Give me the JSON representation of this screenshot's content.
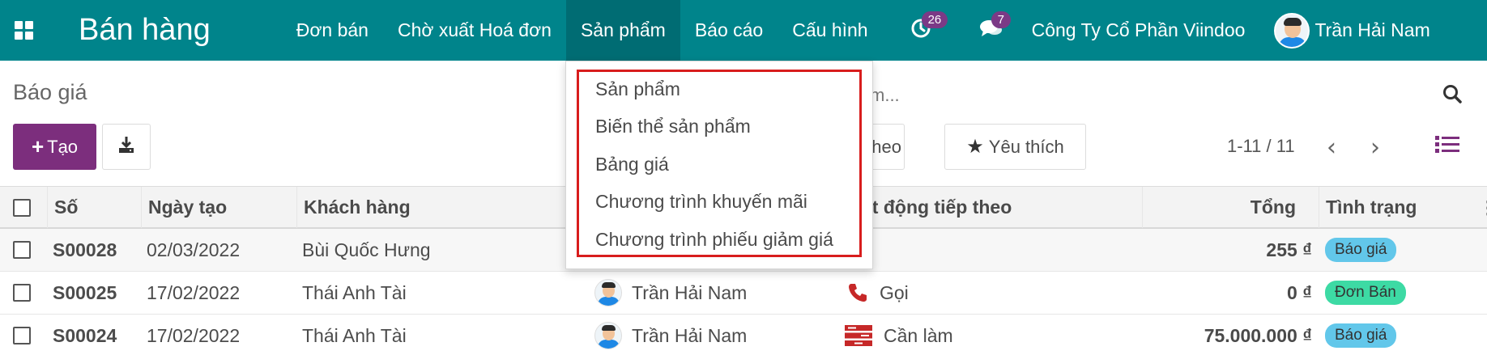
{
  "navbar": {
    "brand": "Bán hàng",
    "menu": [
      {
        "label": "Đơn bán",
        "active": false
      },
      {
        "label": "Chờ xuất Hoá đơn",
        "active": false
      },
      {
        "label": "Sản phẩm",
        "active": true
      },
      {
        "label": "Báo cáo",
        "active": false
      },
      {
        "label": "Cấu hình",
        "active": false
      }
    ],
    "activity_count": "26",
    "message_count": "7",
    "company": "Công Ty Cổ Phần Viindoo",
    "user_name": "Trần Hải Nam",
    "icons": {
      "apps": "apps-grid-icon",
      "activity": "clock-icon",
      "messages": "chat-icon"
    }
  },
  "control_panel": {
    "breadcrumb": "Báo giá",
    "search_partial": "m...",
    "create_label": "Tạo",
    "groupby_partial": "heo",
    "favorites_label": "Yêu thích",
    "pager": "1-11 / 11",
    "pager_prev": "‹",
    "pager_next": "›"
  },
  "dropdown": {
    "items": [
      "Sản phẩm",
      "Biến thể sản phẩm",
      "Bảng giá",
      "Chương trình khuyến mãi",
      "Chương trình phiếu giảm giá"
    ],
    "highlight_color": "#d81d1d"
  },
  "table": {
    "headers": {
      "number": "Số",
      "date": "Ngày tạo",
      "customer": "Khách hàng",
      "next_activity_partial": "ạt động tiếp theo",
      "total": "Tổng",
      "status": "Tình trạng"
    },
    "rows": [
      {
        "number": "S00028",
        "date": "02/03/2022",
        "customer": "Bùi Quốc Hưng",
        "salesperson": "",
        "activity": "",
        "activity_icon": "",
        "total": "255 ₫",
        "status": "Báo giá",
        "status_color": "#62c7ea"
      },
      {
        "number": "S00025",
        "date": "17/02/2022",
        "customer": "Thái Anh Tài",
        "salesperson": "Trần Hải Nam",
        "activity": "Gọi",
        "activity_icon": "phone-icon",
        "total": "0 ₫",
        "status": "Đơn Bán",
        "status_color": "#3ddaa4"
      },
      {
        "number": "S00024",
        "date": "17/02/2022",
        "customer": "Thái Anh Tài",
        "salesperson": "Trần Hải Nam",
        "activity": "Cần làm",
        "activity_icon": "tasks-icon",
        "total": "75.000.000 ₫",
        "status": "Báo giá",
        "status_color": "#62c7ea"
      }
    ]
  },
  "colors": {
    "navbar": "#00848b",
    "navbar_active": "#006c73",
    "primary_button": "#7c2e7d",
    "badge": "#7b3a86",
    "activity_icon": "#c62828"
  }
}
